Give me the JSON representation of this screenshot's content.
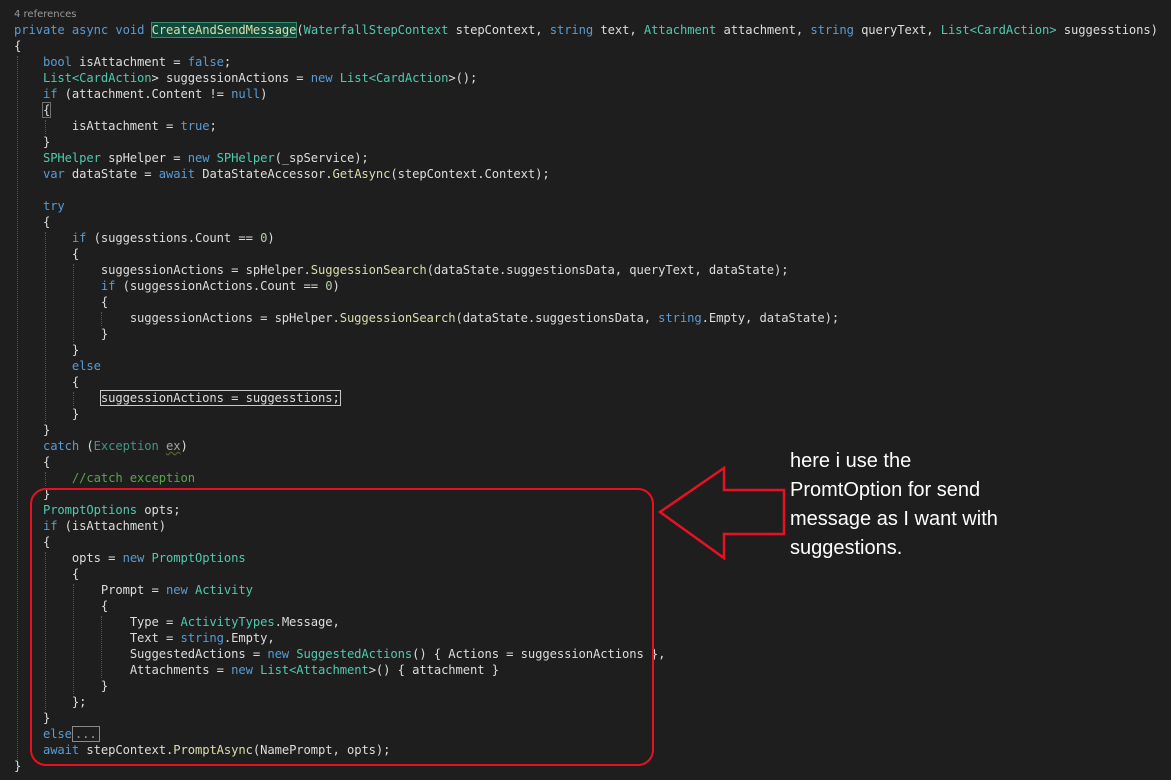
{
  "header": {
    "references": "4 references"
  },
  "code": {
    "sig_private": "private",
    "sig_async": "async",
    "sig_void": "void",
    "method_name": "CreateAndSendMessage",
    "sig_params": {
      "p1_type": "WaterfallStepContext",
      "p1_name": "stepContext,",
      "p2_type": "string",
      "p2_name": "text,",
      "p3_type": "Attachment",
      "p3_name": "attachment,",
      "p4_type": "string",
      "p4_name": "queryText,",
      "p5_type_a": "List<",
      "p5_type_b": "CardAction",
      "p5_type_c": ">",
      "p5_name": "suggesstions)"
    },
    "l_bool": "bool",
    "l_isAtt": " isAttachment = ",
    "l_false": "false",
    "l_semi": ";",
    "l_list1": "List<",
    "l_cardaction": "CardAction",
    "l_list2": "> suggessionActions = ",
    "l_new": "new",
    "l_list3": " List<",
    "l_list4": ">();",
    "l_if": "if",
    "l_attcond": " (attachment.Content != ",
    "l_null": "null",
    "l_close": ")",
    "brace_open": "{",
    "brace_close": "}",
    "l_isAttTrue": "isAttachment = ",
    "l_true": "true",
    "l_sphelper_t": "SPHelper",
    "l_sphelper_v": " spHelper = ",
    "l_sphelper_ctor": " SPHelper",
    "l_sphelper_args": "(_spService);",
    "l_var": "var",
    "l_datastate": " dataState = ",
    "l_await": "await",
    "l_dsa": " DataStateAccessor.",
    "l_getasync": "GetAsync",
    "l_getasync_args": "(stepContext.Context);",
    "l_try": "try",
    "l_ifcount": " (suggesstions.Count == ",
    "l_zero": "0",
    "l_sa_assign": "suggessionActions = spHelper.",
    "l_suggsearch": "SuggessionSearch",
    "l_sa_args1": "(dataState.suggestionsData, queryText, dataState);",
    "l_ifcount2": " (suggessionActions.Count == ",
    "l_sa_args2a": "(dataState.suggestionsData, ",
    "l_string": "string",
    "l_sa_args2b": ".Empty, dataState);",
    "l_else": "else",
    "l_sa_sugg": "suggessionActions = suggesstions;",
    "l_catch": "catch",
    "l_catch_open": " (",
    "l_exception": "Exception",
    "l_ex": "ex",
    "l_comment": "//catch exception",
    "l_promptoptions": "PromptOptions",
    "l_opts": " opts;",
    "l_ifatt": " (isAttachment)",
    "l_opts_assign": "opts = ",
    "l_promptoptions2": " PromptOptions",
    "l_prompt": "Prompt = ",
    "l_activity": " Activity",
    "l_type": "Type = ",
    "l_activitytypes": "ActivityTypes",
    "l_message": ".Message,",
    "l_text": "Text = ",
    "l_empty": ".Empty,",
    "l_suggested": "SuggestedActions = ",
    "l_suggestedactions": " SuggestedActions",
    "l_suggested_rest": "() { Actions = suggessionActions },",
    "l_attachments": "Attachments = ",
    "l_list_att_a": " List<",
    "l_attachment_t": "Attachment",
    "l_list_att_b": ">() { attachment }",
    "l_closeinit": "};",
    "l_ellipsis": "...",
    "l_stepctx": " stepContext.",
    "l_promptasync": "PromptAsync",
    "l_promptasync_args": "(NamePrompt, opts);"
  },
  "annotation": {
    "line1": "here i use the",
    "line2": "PromtOption for send",
    "line3": "message as I want with",
    "line4": "suggestions.",
    "box_color": "#e81123",
    "arrow_color": "#e81123"
  },
  "colors": {
    "background": "#1e1e1e",
    "keyword": "#569cd6",
    "type": "#4ec9b0",
    "comment": "#57a64a",
    "number": "#b5cea8",
    "method": "#dcdcaa",
    "text": "#dcdcdc"
  }
}
